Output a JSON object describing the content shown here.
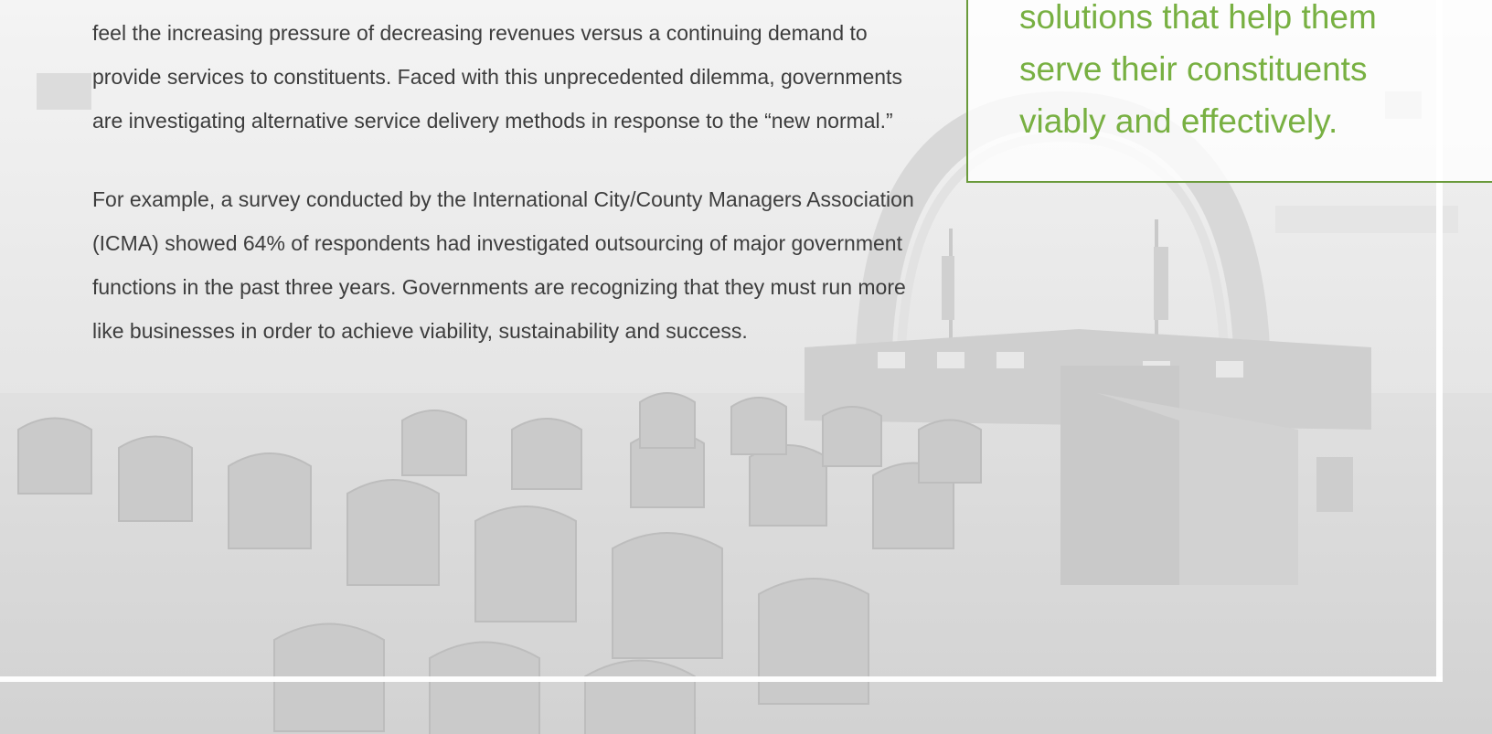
{
  "body": {
    "paragraphs": [
      "feel the increasing pressure of decreasing revenues versus a continuing demand to provide services to constituents. Faced with this unprecedented dilemma, governments are investigating alternative service delivery methods in response to the “new normal.”",
      "For example, a survey conducted by the International City/County Managers Association (ICMA) showed 64% of respondents had investigated outsourcing of major government functions in the past three years. Governments are recognizing that they must run more like businesses in order to achieve viability, sustainability and success."
    ]
  },
  "callout": {
    "lines": [
      "solutions that help them",
      "serve their constituents",
      "viably and effectively."
    ]
  },
  "colors": {
    "accent_green": "#78b042",
    "border_green": "#6a9a3b",
    "body_text": "#3d3d3d"
  }
}
